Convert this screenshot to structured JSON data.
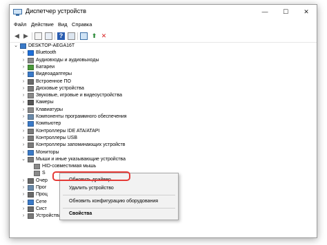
{
  "window": {
    "title": "Диспетчер устройств",
    "min": "—",
    "max": "☐",
    "close": "✕"
  },
  "menu": [
    "Файл",
    "Действие",
    "Вид",
    "Справка"
  ],
  "toolbar": [
    "back-icon",
    "forward-icon",
    "properties-icon",
    "device-list-icon",
    "help-icon",
    "view-icon",
    "scan-icon",
    "update-driver-icon",
    "remove-device-icon"
  ],
  "tree": {
    "root": "DESKTOP-AEGA16T",
    "items": [
      {
        "label": "Bluetooth",
        "icon": "bluetooth-icon",
        "color": "#1e6fd9"
      },
      {
        "label": "Аудиовходы и аудиовыходы",
        "icon": "speaker-icon",
        "color": "#8a8a8a"
      },
      {
        "label": "Батареи",
        "icon": "battery-icon",
        "color": "#4a9a3a"
      },
      {
        "label": "Видеоадаптеры",
        "icon": "display-adapter-icon",
        "color": "#3a7ac8"
      },
      {
        "label": "Встроенное ПО",
        "icon": "firmware-icon",
        "color": "#6a6a6a"
      },
      {
        "label": "Дисковые устройства",
        "icon": "disk-icon",
        "color": "#7a7a7a"
      },
      {
        "label": "Звуковые, игровые и видеоустройства",
        "icon": "sound-icon",
        "color": "#8a8a8a"
      },
      {
        "label": "Камеры",
        "icon": "camera-icon",
        "color": "#555555"
      },
      {
        "label": "Клавиатуры",
        "icon": "keyboard-icon",
        "color": "#8a8a8a"
      },
      {
        "label": "Компоненты программного обеспечения",
        "icon": "software-component-icon",
        "color": "#6a8aaa"
      },
      {
        "label": "Компьютер",
        "icon": "computer-icon",
        "color": "#3a7ac8"
      },
      {
        "label": "Контроллеры IDE ATA/ATAPI",
        "icon": "ide-controller-icon",
        "color": "#7a7a7a"
      },
      {
        "label": "Контроллеры USB",
        "icon": "usb-icon",
        "color": "#7a7a7a"
      },
      {
        "label": "Контроллеры запоминающих устройств",
        "icon": "storage-controller-icon",
        "color": "#7a7a7a"
      },
      {
        "label": "Мониторы",
        "icon": "monitor-icon",
        "color": "#3a7ac8"
      },
      {
        "label": "Мыши и иные указывающие устройства",
        "icon": "mouse-icon",
        "color": "#7a7a7a"
      }
    ],
    "children": [
      {
        "label": "HID-совместимая мышь",
        "icon": "mouse-icon"
      },
      {
        "label": "S",
        "icon": "mouse-icon"
      }
    ],
    "after": [
      {
        "label": "Очер",
        "icon": "print-queue-icon",
        "color": "#6a6a6a"
      },
      {
        "label": "Прог",
        "icon": "software-device-icon",
        "color": "#6a8aaa"
      },
      {
        "label": "Проц",
        "icon": "processor-icon",
        "color": "#6a6a6a"
      },
      {
        "label": "Сете",
        "icon": "network-icon",
        "color": "#3a7ac8"
      },
      {
        "label": "Сист",
        "icon": "system-device-icon",
        "color": "#6a6a6a"
      },
      {
        "label": "Устройства HID (Human Interface Devices)",
        "icon": "hid-icon",
        "color": "#7a7a7a"
      }
    ]
  },
  "context_menu": {
    "update_driver": "Обновить драйвер",
    "remove_device": "Удалить устройство",
    "scan_hardware": "Обновить конфигурацию оборудования",
    "properties": "Свойства"
  },
  "colors": {
    "highlight": "#e53935",
    "menu_bg": "#f2f2f2"
  }
}
